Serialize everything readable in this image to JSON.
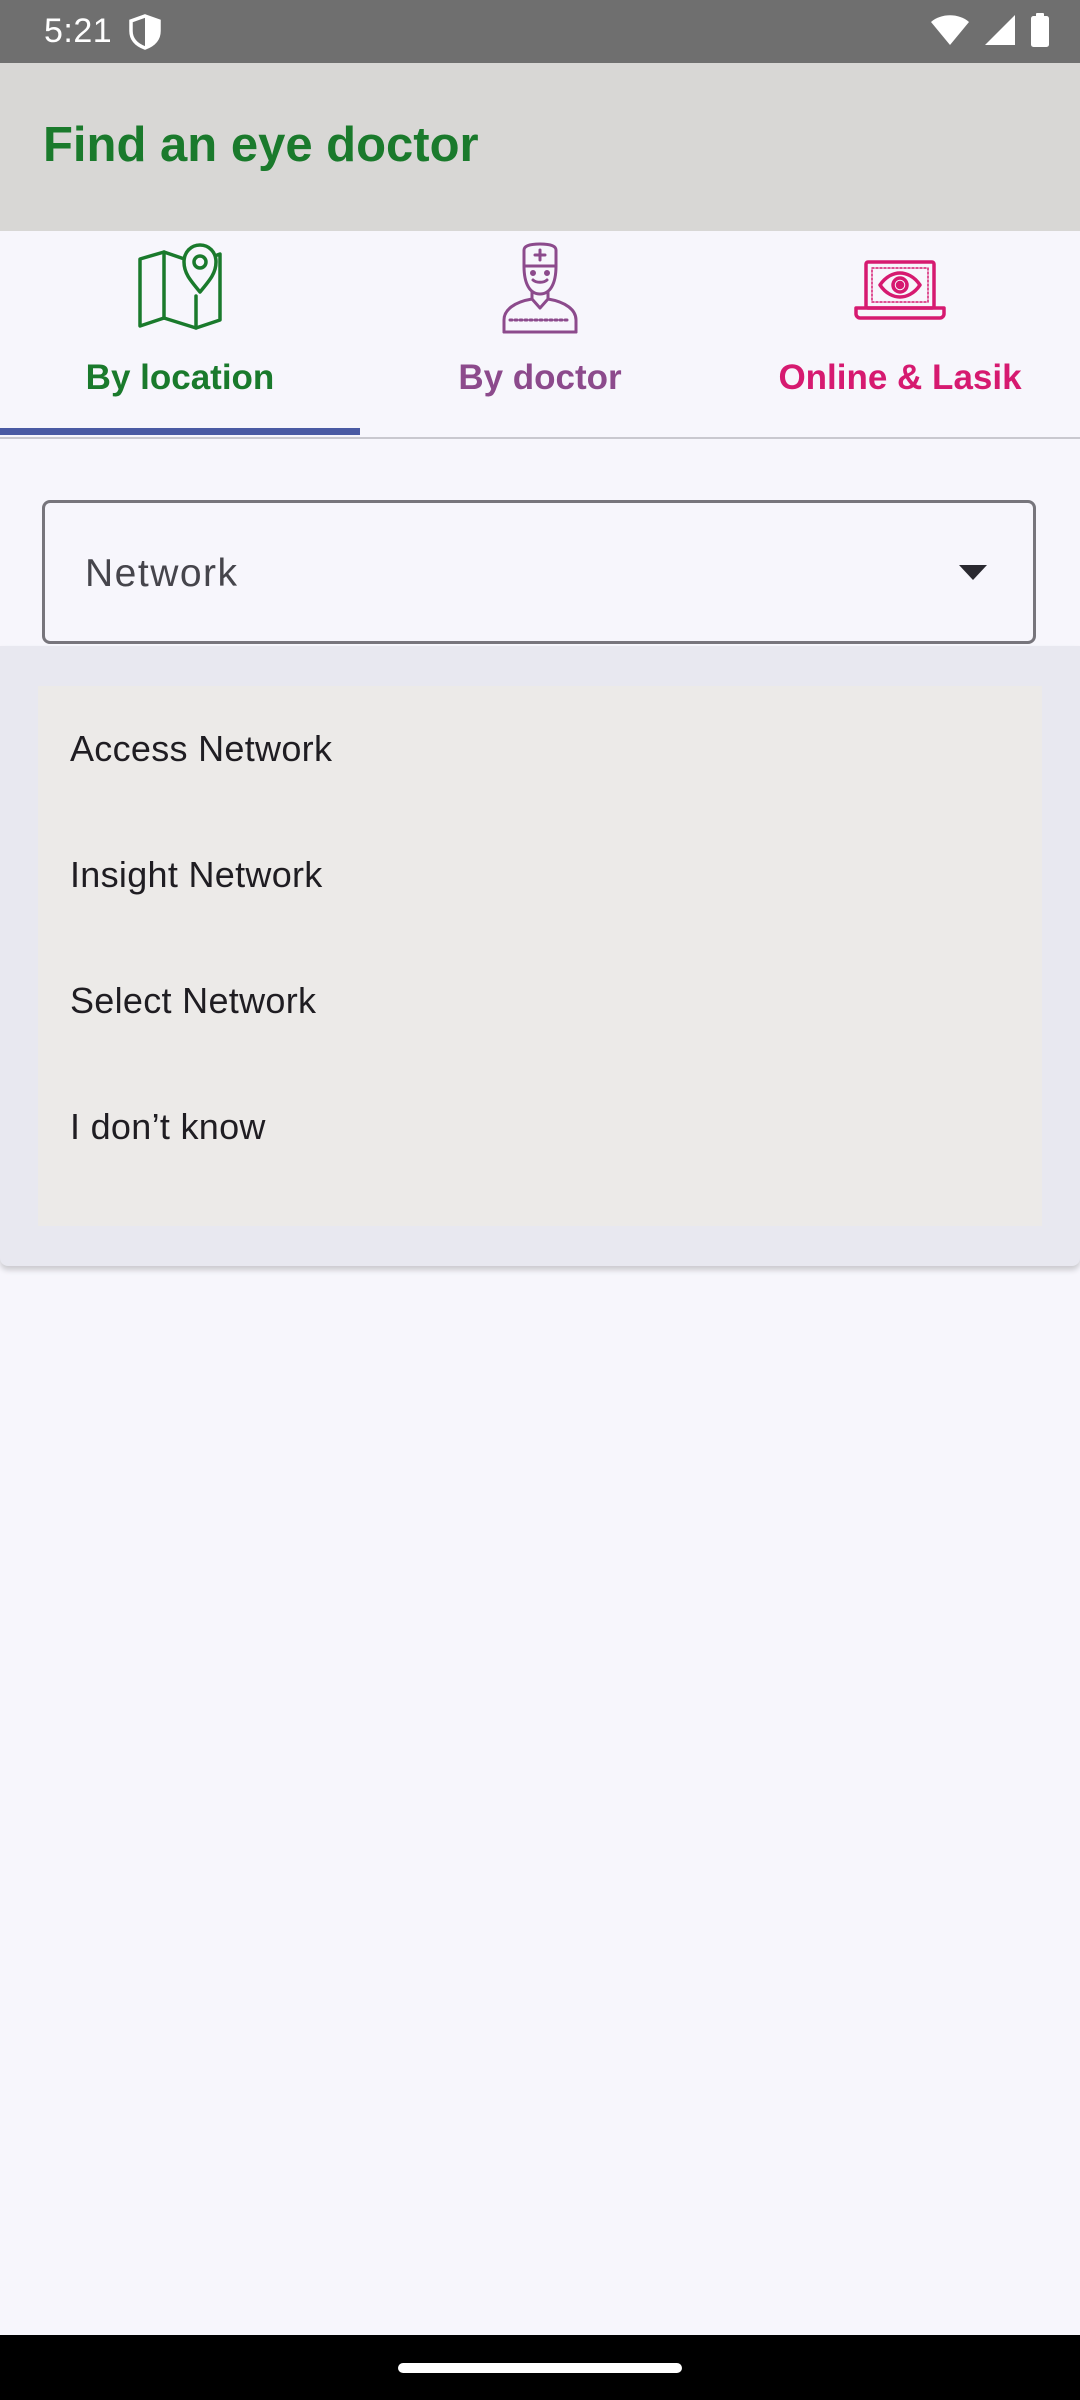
{
  "status_bar": {
    "time": "5:21"
  },
  "app_bar": {
    "title": "Find an eye doctor"
  },
  "tabs": [
    {
      "label": "By location",
      "icon": "map-pin-icon",
      "color": "#1a7a2c",
      "selected": true
    },
    {
      "label": "By doctor",
      "icon": "doctor-icon",
      "color": "#8c4a8c",
      "selected": false
    },
    {
      "label": "Online & Lasik",
      "icon": "laptop-eye-icon",
      "color": "#d61a70",
      "selected": false
    }
  ],
  "dropdown": {
    "value": "Network",
    "options": [
      "Access Network",
      "Insight Network",
      "Select Network",
      "I don’t know"
    ]
  },
  "colors": {
    "brand_green": "#1a7a2c",
    "tab_indicator": "#4a5aa3",
    "status_bar": "#6f6f6f",
    "app_bar": "#d8d7d5"
  }
}
